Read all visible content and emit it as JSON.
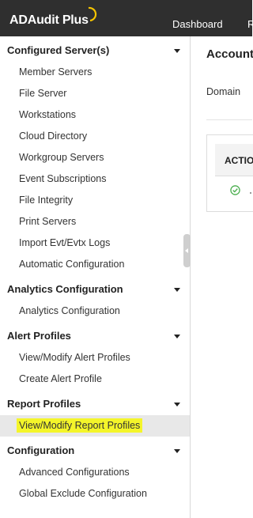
{
  "app": {
    "logo_text": "ADAudit Plus"
  },
  "topnav": {
    "dashboard": "Dashboard",
    "next_tab": "R"
  },
  "sidebar": {
    "sections": [
      {
        "title": "Configured Server(s)",
        "items": [
          "Member Servers",
          "File Server",
          "Workstations",
          "Cloud Directory",
          "Workgroup Servers",
          "Event Subscriptions",
          "File Integrity",
          "Print Servers",
          "Import Evt/Evtx Logs",
          "Automatic Configuration"
        ]
      },
      {
        "title": "Analytics Configuration",
        "items": [
          "Analytics Configuration"
        ]
      },
      {
        "title": "Alert Profiles",
        "items": [
          "View/Modify Alert Profiles",
          "Create Alert Profile"
        ]
      },
      {
        "title": "Report Profiles",
        "items": [
          "View/Modify Report Profiles"
        ]
      },
      {
        "title": "Configuration",
        "items": [
          "Advanced Configurations",
          "Global Exclude Configuration"
        ]
      }
    ],
    "active_item": "View/Modify Report Profiles"
  },
  "main": {
    "title": "Account",
    "domain_label": "Domain",
    "table": {
      "header": "ACTIO"
    }
  },
  "colors": {
    "topbar": "#2f2f2f",
    "highlight": "#f4f52a",
    "check": "#4caf50"
  }
}
